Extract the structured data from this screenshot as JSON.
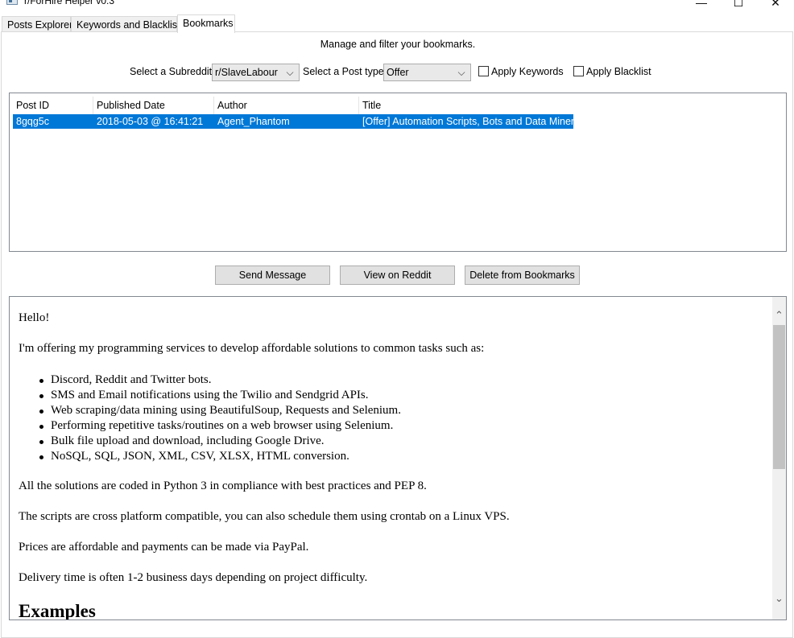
{
  "window": {
    "title": "r/ForHire Helper v0.3",
    "controls": {
      "minimize": "—",
      "maximize": "☐",
      "close": "✕"
    }
  },
  "tabs": [
    {
      "label": "Posts Explorer",
      "active": false
    },
    {
      "label": "Keywords and Blacklist",
      "active": false
    },
    {
      "label": "Bookmarks",
      "active": true
    }
  ],
  "bookmarks": {
    "subtitle": "Manage and filter your bookmarks.",
    "filters": {
      "subreddit_label": "Select a Subreddit:",
      "subreddit_value": "r/SlaveLabour",
      "post_type_label": "Select a Post type:",
      "post_type_value": "Offer",
      "apply_keywords": {
        "label": "Apply Keywords",
        "checked": false
      },
      "apply_blacklist": {
        "label": "Apply Blacklist",
        "checked": false
      }
    },
    "table": {
      "columns": [
        "Post ID",
        "Published Date",
        "Author",
        "Title"
      ],
      "rows": [
        {
          "post_id": "8gqg5c",
          "published": "2018-05-03 @ 16:41:21",
          "author": "Agent_Phantom",
          "title": "[Offer] Automation Scripts, Bots and Data Miners",
          "selected": true
        }
      ]
    },
    "buttons": {
      "send_message": "Send Message",
      "view_on_reddit": "View on Reddit",
      "delete": "Delete from Bookmarks"
    },
    "post": {
      "greeting": "Hello!",
      "intro": "I'm offering my programming services to develop affordable solutions to common tasks such as:",
      "bullets": [
        "Discord, Reddit and Twitter bots.",
        "SMS and Email notifications using the Twilio and Sendgrid APIs.",
        "Web scraping/data mining using BeautifulSoup, Requests and Selenium.",
        "Performing repetitive tasks/routines on a web browser using Selenium.",
        "Bulk file upload and download, including Google Drive.",
        "NoSQL, SQL, JSON, XML, CSV, XLSX, HTML conversion."
      ],
      "p1": "All the solutions are coded in Python 3 in compliance with best practices and PEP 8.",
      "p2": "The scripts are cross platform compatible, you can also schedule them using crontab on a Linux VPS.",
      "p3": "Prices are affordable and payments can be made via PayPal.",
      "p4": "Delivery time is often 1-2 business days depending on project difficulty.",
      "heading": "Examples"
    }
  }
}
